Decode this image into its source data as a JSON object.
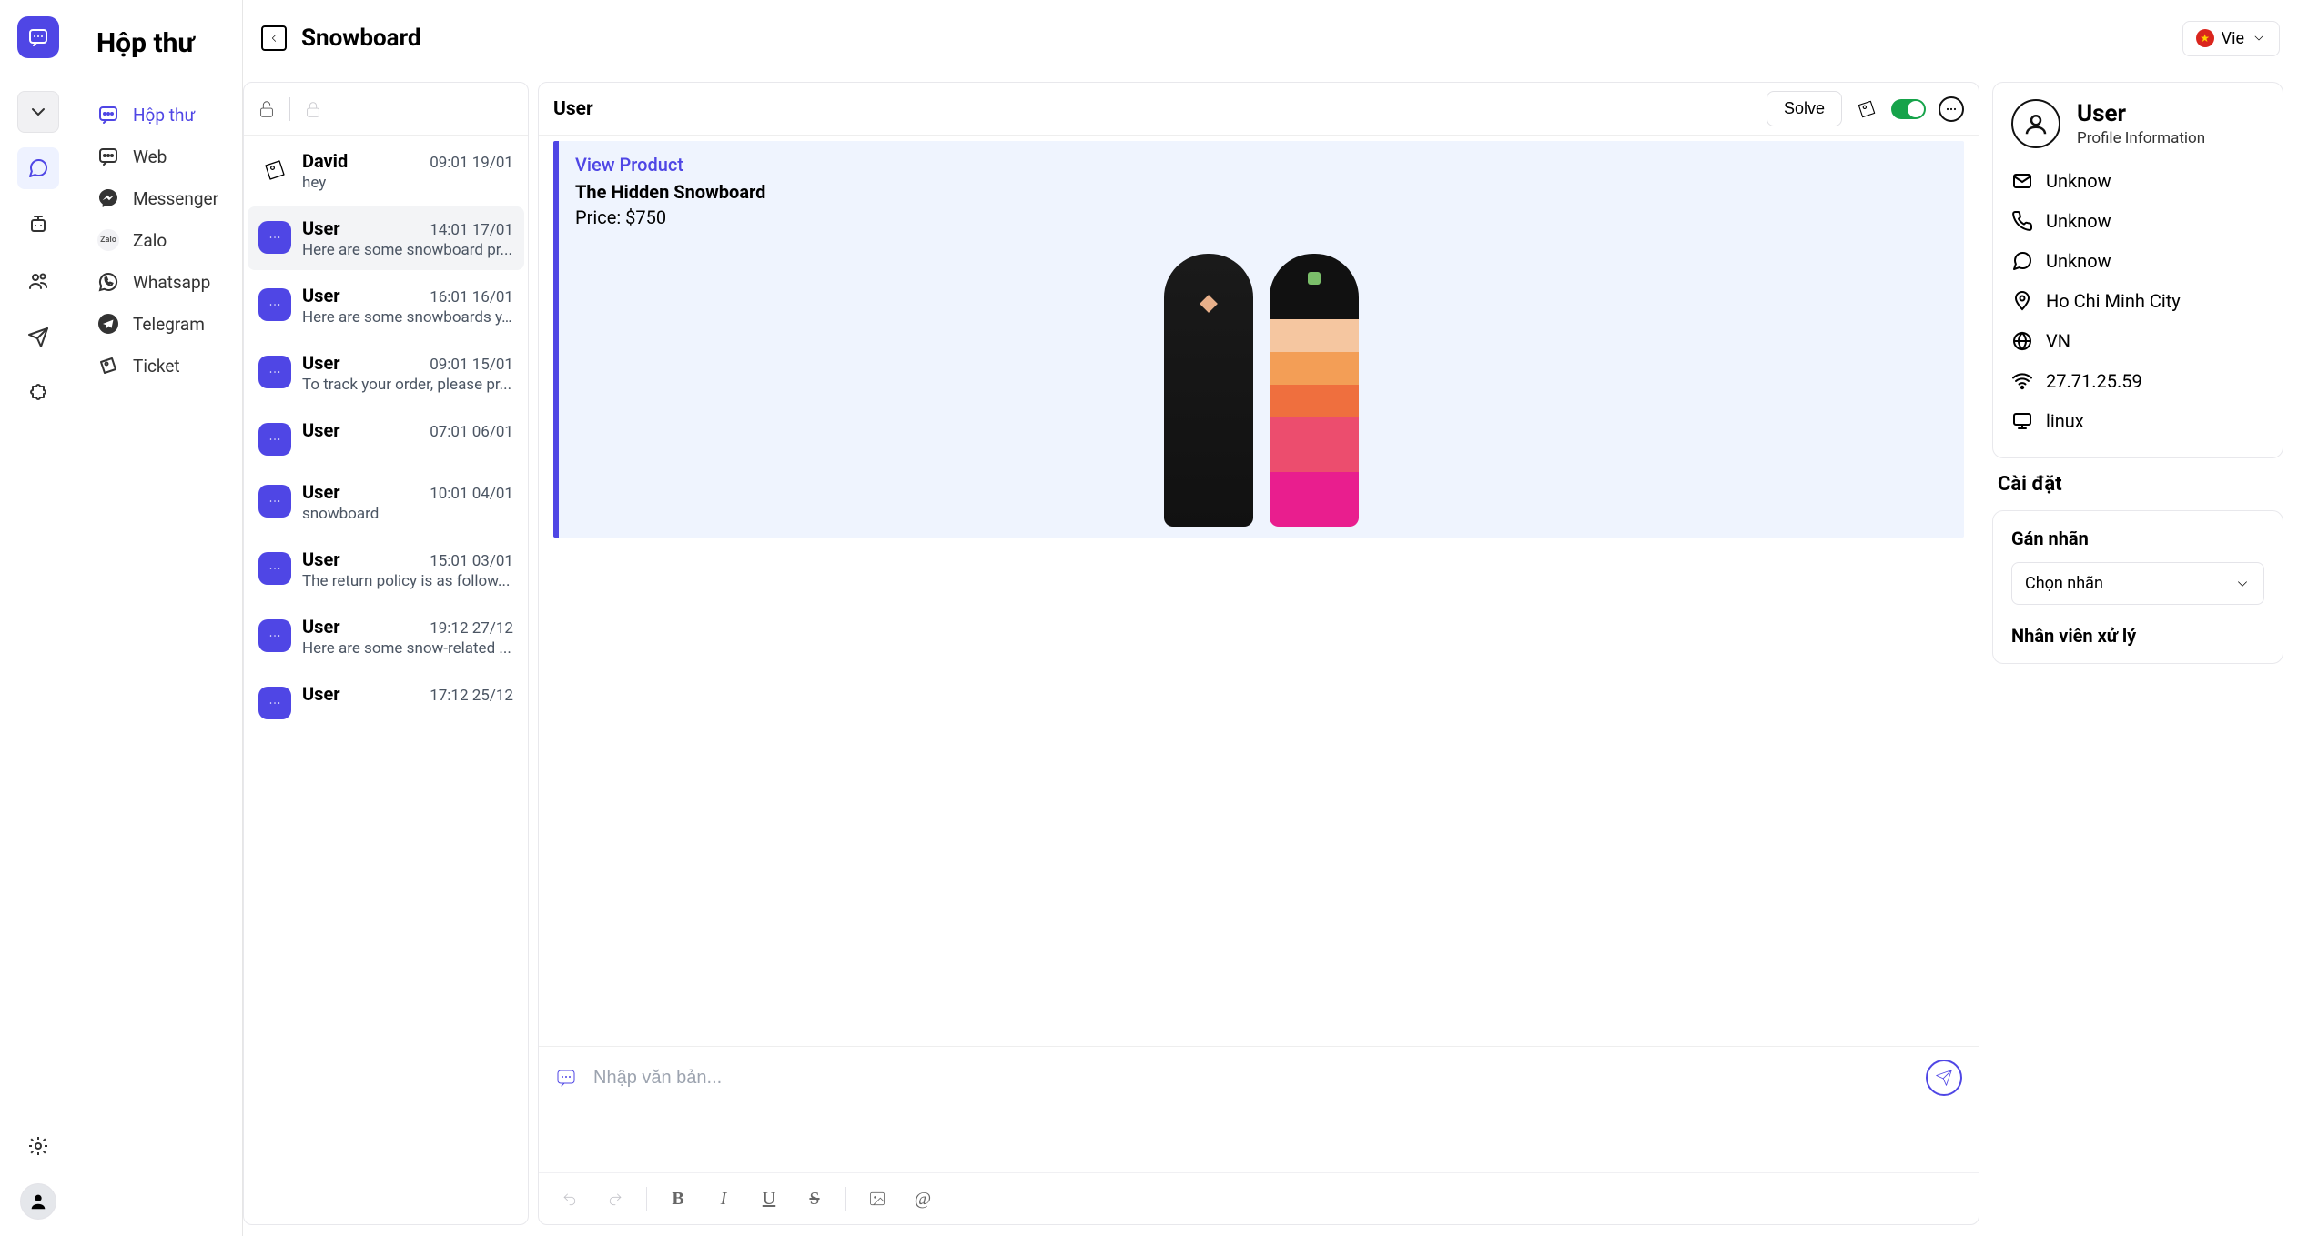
{
  "header": {
    "app_title": "Hộp thư",
    "page_title": "Snowboard",
    "lang_label": "Vie"
  },
  "channels": [
    {
      "id": "inbox",
      "label": "Hộp thư",
      "icon": "chat",
      "active": true
    },
    {
      "id": "web",
      "label": "Web",
      "icon": "chat-dots"
    },
    {
      "id": "messenger",
      "label": "Messenger",
      "icon": "messenger"
    },
    {
      "id": "zalo",
      "label": "Zalo",
      "icon": "zalo"
    },
    {
      "id": "whatsapp",
      "label": "Whatsapp",
      "icon": "whatsapp"
    },
    {
      "id": "telegram",
      "label": "Telegram",
      "icon": "telegram"
    },
    {
      "id": "ticket",
      "label": "Ticket",
      "icon": "ticket"
    }
  ],
  "conversations": [
    {
      "name": "David",
      "time": "09:01 19/01",
      "preview": "hey",
      "icon": "ticket"
    },
    {
      "name": "User",
      "time": "14:01 17/01",
      "preview": "Here are some snowboard pr...",
      "icon": "chat",
      "active": true
    },
    {
      "name": "User",
      "time": "16:01 16/01",
      "preview": "Here are some snowboards y...",
      "icon": "chat"
    },
    {
      "name": "User",
      "time": "09:01 15/01",
      "preview": "To track your order, please pr...",
      "icon": "chat"
    },
    {
      "name": "User",
      "time": "07:01 06/01",
      "preview": "",
      "icon": "chat"
    },
    {
      "name": "User",
      "time": "10:01 04/01",
      "preview": "snowboard",
      "icon": "chat"
    },
    {
      "name": "User",
      "time": "15:01 03/01",
      "preview": "The return policy is as follow...",
      "icon": "chat"
    },
    {
      "name": "User",
      "time": "19:12 27/12",
      "preview": "Here are some snow-related ...",
      "icon": "chat"
    },
    {
      "name": "User",
      "time": "17:12 25/12",
      "preview": "",
      "icon": "chat"
    }
  ],
  "chat": {
    "user_name": "User",
    "solve_label": "Solve",
    "product": {
      "link_text": "View Product",
      "name": "The Hidden Snowboard",
      "price_label": "Price: $750"
    },
    "composer": {
      "placeholder": "Nhập văn bản..."
    }
  },
  "profile": {
    "name": "User",
    "subtitle": "Profile Information",
    "rows": [
      {
        "icon": "mail",
        "value": "Unknow"
      },
      {
        "icon": "phone",
        "value": "Unknow"
      },
      {
        "icon": "chat",
        "value": "Unknow"
      },
      {
        "icon": "pin",
        "value": "Ho Chi Minh City"
      },
      {
        "icon": "globe",
        "value": "VN"
      },
      {
        "icon": "wifi",
        "value": "27.71.25.59"
      },
      {
        "icon": "monitor",
        "value": "linux"
      }
    ]
  },
  "settings": {
    "title": "Cài đặt",
    "label_title": "Gán nhãn",
    "label_placeholder": "Chọn nhãn",
    "assignee_title": "Nhân viên xử lý"
  }
}
